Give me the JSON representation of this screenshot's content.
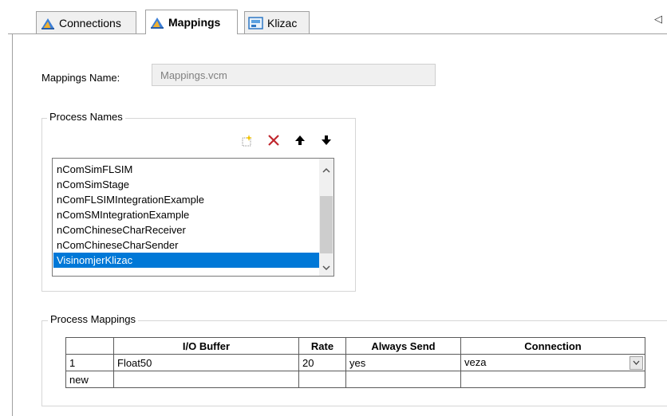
{
  "tabs": [
    {
      "label": "Connections",
      "icon": "connections-icon",
      "active": false
    },
    {
      "label": "Mappings",
      "icon": "mappings-icon",
      "active": true
    },
    {
      "label": "Klizac",
      "icon": "klizac-icon",
      "active": false
    }
  ],
  "tab_scroll_glyph": "◁",
  "mappings_name": {
    "label": "Mappings Name:",
    "value": "Mappings.vcm"
  },
  "process_names": {
    "title": "Process Names",
    "toolbar": [
      "new-item-icon",
      "delete-icon",
      "move-up-icon",
      "move-down-icon"
    ],
    "items": [
      "nComSimFLSIM",
      "nComSimStage",
      "nComFLSIMIntegrationExample",
      "nComSMIntegrationExample",
      "nComChineseCharReceiver",
      "nComChineseCharSender",
      "VisinomjerKlizac"
    ],
    "selected_index": 6
  },
  "process_mappings": {
    "title": "Process Mappings",
    "columns": [
      "",
      "I/O Buffer",
      "Rate",
      "Always Send",
      "Connection"
    ],
    "rows": [
      [
        "1",
        "Float50",
        "20",
        "yes",
        "veza"
      ],
      [
        "new",
        "",
        "",
        "",
        ""
      ]
    ]
  },
  "colors": {
    "selection": "#0078d7",
    "delete": "#c0272d"
  }
}
